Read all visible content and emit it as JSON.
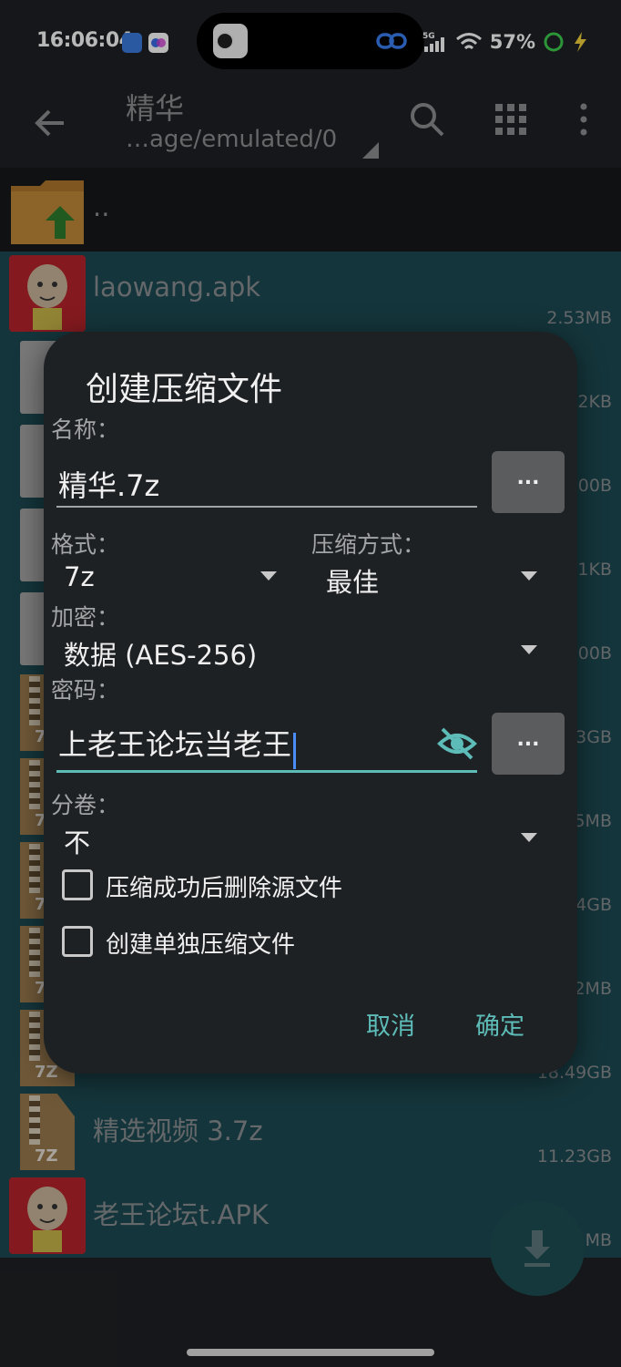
{
  "status_bar": {
    "time": "16:06:04",
    "network": "5G",
    "battery": "57%"
  },
  "toolbar": {
    "title": "精华",
    "path": "…age/emulated/0",
    "back_icon": "arrow-left-icon",
    "search_icon": "search-icon",
    "grid_icon": "grid-view-icon",
    "menu_icon": "more-vert-icon"
  },
  "file_list": {
    "parent": "..",
    "files": [
      {
        "name": "laowang.apk",
        "size": "2.53MB",
        "type": "apk"
      },
      {
        "name": "",
        "size": "2KB",
        "type": "doc"
      },
      {
        "name": "",
        "size": ".00B",
        "type": "doc"
      },
      {
        "name": "",
        "size": "1KB",
        "type": "doc"
      },
      {
        "name": "",
        "size": ".00B",
        "type": "doc"
      },
      {
        "name": "",
        "size": "3GB",
        "type": "zip"
      },
      {
        "name": "",
        "size": "5MB",
        "type": "zip"
      },
      {
        "name": "",
        "size": "4GB",
        "type": "zip"
      },
      {
        "name": "",
        "size": "2MB",
        "type": "zip"
      },
      {
        "name": "",
        "size": "18.49GB",
        "type": "zip"
      },
      {
        "name": "精选视频 3.7z",
        "size": "11.23GB",
        "type": "zip"
      },
      {
        "name": "老王论坛t.APK",
        "size": "MB",
        "type": "apk"
      }
    ],
    "zip_label": "7Z"
  },
  "dialog": {
    "title": "创建压缩文件",
    "name_label": "名称：",
    "name_value": "精华.7z",
    "browse_label": "...",
    "format_label": "格式：",
    "format_value": "7z",
    "method_label": "压缩方式：",
    "method_value": "最佳",
    "encrypt_label": "加密：",
    "encrypt_value": "数据 (AES-256)",
    "password_label": "密码：",
    "password_value": "上老王论坛当老王",
    "split_label": "分卷：",
    "split_value": "不",
    "delete_source_label": "压缩成功后删除源文件",
    "separate_archive_label": "创建单独压缩文件",
    "cancel": "取消",
    "ok": "确定",
    "accent_color": "#5dbcb8"
  }
}
